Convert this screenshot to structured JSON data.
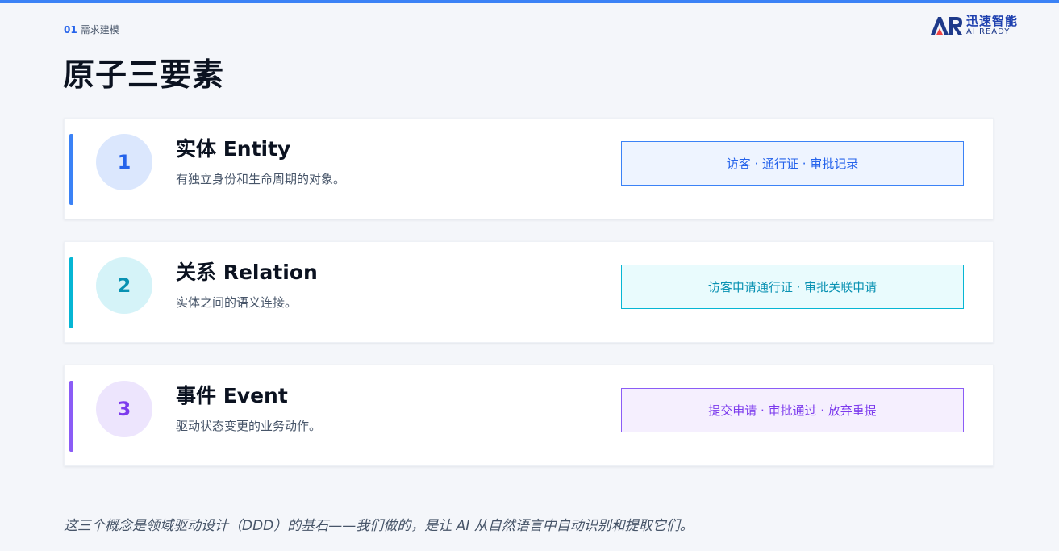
{
  "header": {
    "section_number": "01",
    "section_label": "需求建模",
    "title": "原子三要素"
  },
  "logo": {
    "mark": "AR",
    "cn_name": "迅速智能",
    "en_name": "AI READY"
  },
  "colors": {
    "top_bar": "#3b82f6",
    "entity": "#3b82f6",
    "relation": "#06b6d4",
    "event": "#8b5cf6"
  },
  "cards": [
    {
      "number": "1",
      "title": "实体 Entity",
      "description": "有独立身份和生命周期的对象。",
      "examples": "访客 · 通行证 · 审批记录"
    },
    {
      "number": "2",
      "title": "关系 Relation",
      "description": "实体之间的语义连接。",
      "examples": "访客申请通行证 · 审批关联申请"
    },
    {
      "number": "3",
      "title": "事件 Event",
      "description": "驱动状态变更的业务动作。",
      "examples": "提交申请 · 审批通过 · 放弃重提"
    }
  ],
  "footnote": "这三个概念是领域驱动设计（DDD）的基石——我们做的，是让 AI 从自然语言中自动识别和提取它们。"
}
